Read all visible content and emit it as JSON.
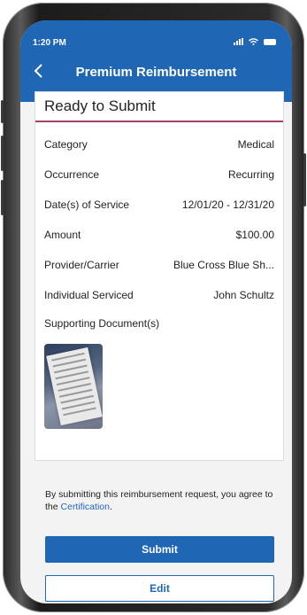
{
  "status_bar": {
    "time": "1:20 PM"
  },
  "header": {
    "title": "Premium Reimbursement"
  },
  "card": {
    "title": "Ready to Submit",
    "rows": [
      {
        "label": "Category",
        "value": "Medical"
      },
      {
        "label": "Occurrence",
        "value": "Recurring"
      },
      {
        "label": "Date(s) of Service",
        "value": "12/01/20 - 12/31/20"
      },
      {
        "label": "Amount",
        "value": "$100.00"
      },
      {
        "label": "Provider/Carrier",
        "value": "Blue Cross Blue Sh..."
      },
      {
        "label": "Individual Serviced",
        "value": "John Schultz"
      }
    ],
    "documents_label": "Supporting Document(s)"
  },
  "agreement": {
    "text": "By submitting this reimbursement request, you agree to the ",
    "link": "Certification",
    "suffix": "."
  },
  "buttons": {
    "submit": "Submit",
    "edit": "Edit"
  },
  "colors": {
    "primary": "#1f66b5",
    "divider": "#a4426a"
  }
}
